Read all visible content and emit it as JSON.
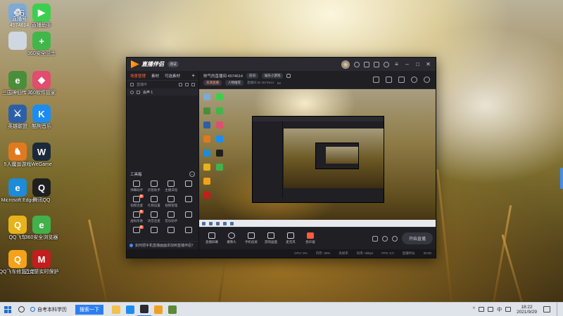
{
  "desktop": {
    "icons": [
      {
        "label": "",
        "color": "#7fa9d6",
        "glyph": "♻"
      },
      {
        "label": "直播助手",
        "color": "#3ccf4e",
        "glyph": "▶"
      },
      {
        "label": "",
        "color": "#cfd7e0",
        "glyph": ""
      },
      {
        "label": "360安全卫士",
        "color": "#41b64b",
        "glyph": "+"
      },
      {
        "label": "三国神仙传 用",
        "color": "#4b8e3a",
        "glyph": "e"
      },
      {
        "label": "360软件管家",
        "color": "#e14d6e",
        "glyph": "◆"
      },
      {
        "label": "英雄联盟",
        "color": "#2d5fa8",
        "glyph": "⚔"
      },
      {
        "label": "酷狗音乐",
        "color": "#1c8df0",
        "glyph": "K"
      },
      {
        "label": "5人魔兽游戏",
        "color": "#e07a1e",
        "glyph": "♞"
      },
      {
        "label": "WeGame",
        "color": "#1b2a3a",
        "glyph": "W"
      },
      {
        "label": "Microsoft Edge",
        "color": "#1d8bd8",
        "glyph": "e"
      },
      {
        "label": "腾讯QQ",
        "color": "#1f1f1f",
        "glyph": "Q"
      },
      {
        "label": "QQ飞车",
        "color": "#e8b21b",
        "glyph": "Q"
      },
      {
        "label": "360安全浏览器",
        "color": "#42b14b",
        "glyph": "e"
      },
      {
        "label": "QQ飞车修复工具",
        "color": "#f3a21a",
        "glyph": "Q"
      },
      {
        "label": "迈克菲实时保护",
        "color": "#c31d1d",
        "glyph": "M"
      }
    ],
    "watermark": {
      "brand": "16",
      "title": "直播号",
      "id": "4574614"
    }
  },
  "app": {
    "name": "直播伴侣",
    "version": "测试",
    "left_tabs": [
      "场景管理",
      "素材",
      "可选素材"
    ],
    "scene_label": "直播中",
    "source_item": "会声 1",
    "toolbox_title": "工具箱",
    "tools": [
      {
        "label": "弹幕助手",
        "tag": ""
      },
      {
        "label": "房管助手",
        "tag": ""
      },
      {
        "label": "主播日程",
        "tag": ""
      },
      {
        "label": "",
        "tag": ""
      },
      {
        "label": "视频连麦",
        "tag": "新"
      },
      {
        "label": "礼物设置",
        "tag": ""
      },
      {
        "label": "视频管理",
        "tag": ""
      },
      {
        "label": "",
        "tag": ""
      },
      {
        "label": "虚拟形象",
        "tag": "新"
      },
      {
        "label": "语音连麦",
        "tag": ""
      },
      {
        "label": "音乐助手",
        "tag": ""
      },
      {
        "label": "",
        "tag": ""
      },
      {
        "label": "",
        "tag": "新"
      },
      {
        "label": "",
        "tag": ""
      },
      {
        "label": "",
        "tag": ""
      },
      {
        "label": "",
        "tag": ""
      }
    ],
    "notice": "如何把手机直播画面添加到直播伴侣？",
    "room": {
      "title": "帅气的直播间 4574614",
      "edit_chip": "房间",
      "category": "娱乐小游戏",
      "tag1": "高清直播",
      "tag2": "人物推荐",
      "fans_label": "直播间 ID 4574614",
      "likes": "50"
    },
    "controls": [
      {
        "label": "直播屏幕",
        "shape": "square"
      },
      {
        "label": "摄像头",
        "shape": "round"
      },
      {
        "label": "手机投屏",
        "shape": "square"
      },
      {
        "label": "游戏画面",
        "shape": "square"
      },
      {
        "label": "麦克风",
        "shape": "square"
      },
      {
        "label": "扬声器",
        "shape": "audio"
      }
    ],
    "go_live": "开始直播",
    "status": [
      "CPU: 0%",
      "内存: 35%",
      "丢帧率",
      "码率: 0kbps",
      "FPS: 0.0",
      "直播时长",
      "00:00"
    ]
  },
  "taskbar": {
    "search_text": "自考本科学历",
    "search_button": "搜索一下",
    "apps": [
      {
        "name": "folder",
        "color": "#f2c14e"
      },
      {
        "name": "kugou",
        "color": "#1c8df0"
      },
      {
        "name": "live-companion",
        "color": "#2a2a30"
      },
      {
        "name": "game",
        "color": "#f0a020"
      },
      {
        "name": "misc",
        "color": "#5c8a3a"
      }
    ],
    "ime": "中",
    "time": "18:22",
    "date": "2021/9/29"
  }
}
